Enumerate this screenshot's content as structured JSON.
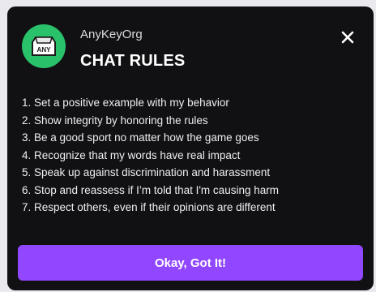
{
  "header": {
    "org_name": "AnyKeyOrg",
    "title": "CHAT RULES",
    "logo_icon": "keyboard-key-icon",
    "logo_text": "ANY",
    "logo_color": "#29c26b",
    "close_icon": "close-icon"
  },
  "rules": [
    "1. Set a positive example with my behavior",
    "2. Show integrity by honoring the rules",
    "3. Be a good sport no matter how the game goes",
    "4. Recognize that my words have real impact",
    "5. Speak up against discrimination and harassment",
    "6. Stop and reassess if I’m told that I'm causing harm",
    "7. Respect others, even if their opinions are different"
  ],
  "footer": {
    "ok_label": "Okay, Got It!",
    "button_color": "#9147ff"
  }
}
